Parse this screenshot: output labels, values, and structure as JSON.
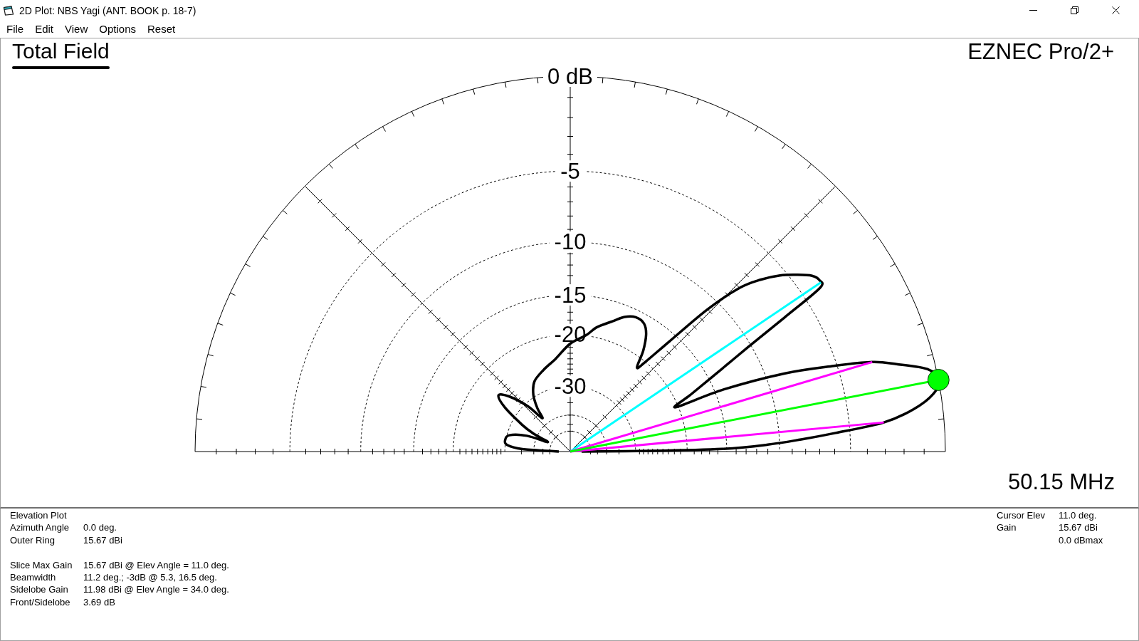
{
  "window": {
    "title": "2D Plot: NBS Yagi (ANT. BOOK p. 18-7)"
  },
  "menu": [
    "File",
    "Edit",
    "View",
    "Options",
    "Reset"
  ],
  "plot": {
    "legend": "Total Field",
    "program_label": "EZNEC Pro/2+",
    "ring_labels": [
      "0 dB",
      "-5",
      "-10",
      "-15",
      "-20",
      "-30"
    ],
    "frequency": "50.15 MHz"
  },
  "info_panel": {
    "plot_type": "Elevation Plot",
    "settings": [
      {
        "label": "Azimuth Angle",
        "value": "0.0 deg."
      },
      {
        "label": "Outer Ring",
        "value": "15.67 dBi"
      }
    ],
    "results": [
      {
        "label": "Slice Max Gain",
        "value": "15.67 dBi @ Elev Angle = 11.0 deg."
      },
      {
        "label": "Beamwidth",
        "value": "11.2 deg.; -3dB @ 5.3, 16.5 deg."
      },
      {
        "label": "Sidelobe Gain",
        "value": "11.98 dBi @ Elev Angle = 34.0 deg."
      },
      {
        "label": "Front/Sidelobe",
        "value": "3.69 dB"
      }
    ],
    "cursor": [
      {
        "label": "Cursor Elev",
        "value": "11.0 deg."
      },
      {
        "label": "Gain",
        "value": "15.67 dBi"
      },
      {
        "value": "0.0 dBmax"
      }
    ]
  }
}
